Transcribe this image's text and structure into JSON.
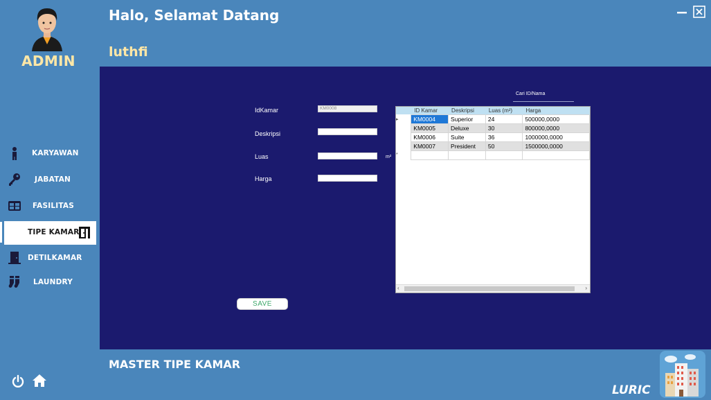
{
  "sidebar": {
    "role": "ADMIN",
    "items": [
      {
        "label": "KARYAWAN",
        "icon": "person-icon"
      },
      {
        "label": "JABATAN",
        "icon": "key-icon"
      },
      {
        "label": "FASILITAS",
        "icon": "grid-icon"
      },
      {
        "label": "TIPE KAMAR",
        "icon": "door-open-icon",
        "active": true
      },
      {
        "label": "DETILKAMAR",
        "icon": "door-icon"
      },
      {
        "label": "LAUNDRY",
        "icon": "socks-icon"
      }
    ]
  },
  "header": {
    "greeting": "Halo, Selamat Datang",
    "username": "luthfi"
  },
  "form": {
    "id_label": "IdKamar",
    "id_value": "KM0008",
    "desc_label": "Deskripsi",
    "desc_value": "",
    "luas_label": "Luas",
    "luas_value": "",
    "luas_unit": "m²",
    "harga_label": "Harga",
    "harga_value": "",
    "save_label": "SAVE"
  },
  "search": {
    "label": "Cari ID/Nama"
  },
  "grid": {
    "columns": [
      "ID Kamar",
      "Deskripsi",
      "Luas (m²)",
      "Harga"
    ],
    "rows": [
      [
        "KM0004",
        "Superior",
        "24",
        "500000,0000"
      ],
      [
        "KM0005",
        "Deluxe",
        "30",
        "800000,0000"
      ],
      [
        "KM0006",
        "Suite",
        "36",
        "1000000,0000"
      ],
      [
        "KM0007",
        "President",
        "50",
        "1500000,0000"
      ]
    ],
    "current_row_marker": "▸",
    "new_row_marker": "*"
  },
  "footer": {
    "title": "MASTER TIPE KAMAR",
    "brand": "LURIC"
  },
  "colors": {
    "sidebar_bg": "#4a86bb",
    "main_bg": "#1b1a6e",
    "accent_text": "#ffe7a6",
    "selected_cell": "#1e78d7",
    "grid_header": "#bfe0f2"
  }
}
